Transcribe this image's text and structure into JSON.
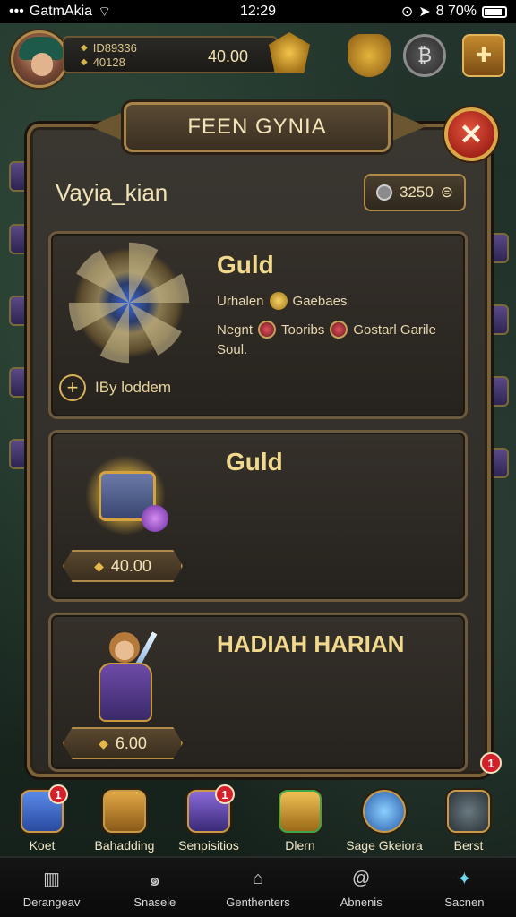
{
  "status_bar": {
    "carrier": "GatmAkia",
    "time": "12:29",
    "battery": "8 70%"
  },
  "hud": {
    "player_line1": "ID89336",
    "player_line2": "40128",
    "main_resource": "40.00"
  },
  "modal": {
    "title": "FEEN GYNIA",
    "section_title": "Vayia_kian",
    "currency_value": "3250"
  },
  "cards": [
    {
      "title": "Guld",
      "stat1_label": "Urhalen",
      "stat1_value": "Gaebaes",
      "stat2_label": "Negnt",
      "stat2_mid": "Tooribs",
      "stat2_value": "Gostarl Garile",
      "stat2_extra": "Soul.",
      "action_label": "IBy loddem"
    },
    {
      "title": "Guld",
      "price": "40.00"
    },
    {
      "title": "HADIAH HARIAN",
      "price": "6.00"
    }
  ],
  "quick_bar": [
    {
      "label": "Koet",
      "badge": "1",
      "color": "#3a6ad0",
      "icon": "shield-gem-icon"
    },
    {
      "label": "Bahadding",
      "badge": "",
      "color": "#c58a2e",
      "icon": "scroll-icon"
    },
    {
      "label": "Senpisitios",
      "badge": "1",
      "color": "#6a48b8",
      "icon": "book-icon"
    },
    {
      "label": "Dlern",
      "badge": "",
      "color": "#d8a040",
      "icon": "chest-icon"
    },
    {
      "label": "Sage Gkeiora",
      "badge": "",
      "color": "#3a84c8",
      "icon": "crystal-icon"
    },
    {
      "label": "Berst",
      "badge": "",
      "color": "#4a5a60",
      "icon": "gear-icon"
    }
  ],
  "float_badge": "1",
  "bottom_nav": [
    {
      "label": "Derangeav",
      "icon": "castle-icon"
    },
    {
      "label": "Snasele",
      "icon": "swirl-icon"
    },
    {
      "label": "Genthenters",
      "icon": "house-icon"
    },
    {
      "label": "Abnenis",
      "icon": "at-icon"
    },
    {
      "label": "Sacnen",
      "icon": "bird-icon"
    }
  ]
}
